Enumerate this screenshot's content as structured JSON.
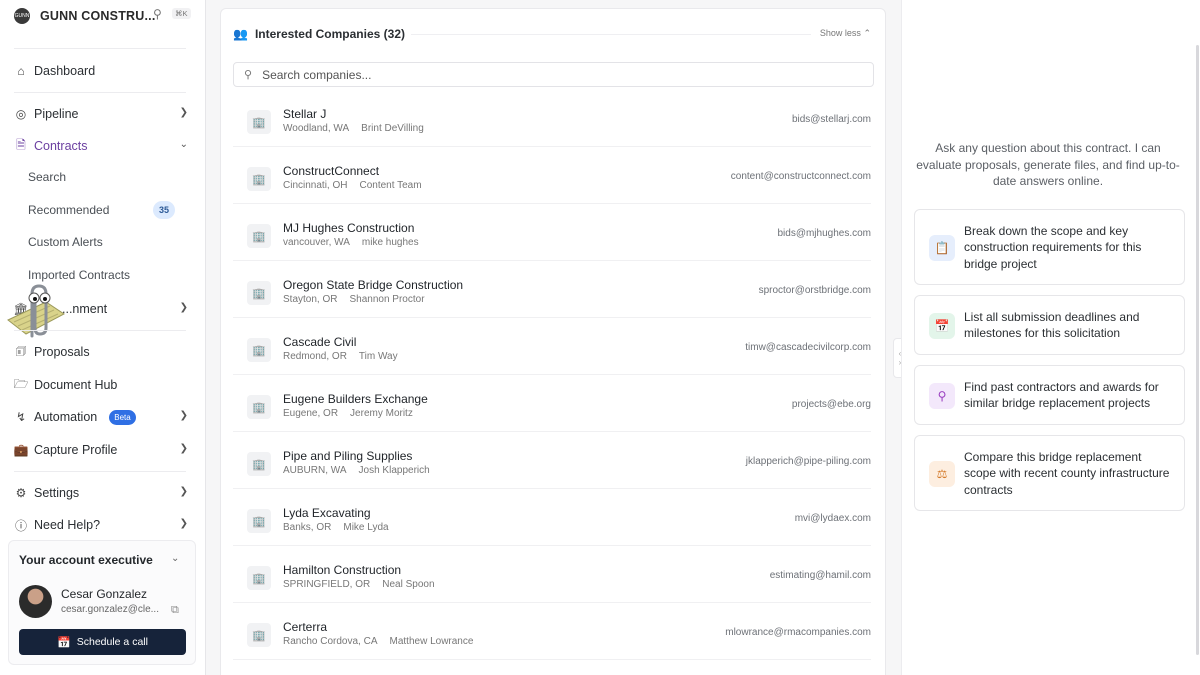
{
  "brand": {
    "name": "GUNN CONSTRU...",
    "logo_text": "GUNN",
    "shortcut": "⌘K"
  },
  "sidebar": {
    "dashboard": "Dashboard",
    "pipeline": "Pipeline",
    "contracts": "Contracts",
    "contracts_sub": {
      "search": "Search",
      "recommended": "Recommended",
      "recommended_count": "35",
      "custom_alerts": "Custom Alerts",
      "imported_contracts": "Imported Contracts",
      "government": "...nment"
    },
    "proposals": "Proposals",
    "document_hub": "Document Hub",
    "automation": "Automation",
    "automation_badge": "Beta",
    "capture_profile": "Capture Profile",
    "settings": "Settings",
    "need_help": "Need Help?"
  },
  "account_exec": {
    "title": "Your account executive",
    "name": "Cesar Gonzalez",
    "email": "cesar.gonzalez@cle...",
    "schedule_label": "Schedule a call"
  },
  "companies_panel": {
    "title": "Interested Companies (32)",
    "toggle": "Show less",
    "search_placeholder": "Search companies...",
    "companies": [
      {
        "name": "Stellar J",
        "location": "Woodland, WA",
        "contact": "Brint DeVilling",
        "email": "bids@stellarj.com"
      },
      {
        "name": "ConstructConnect",
        "location": "Cincinnati, OH",
        "contact": "Content Team",
        "email": "content@constructconnect.com"
      },
      {
        "name": "MJ Hughes Construction",
        "location": "vancouver, WA",
        "contact": "mike hughes",
        "email": "bids@mjhughes.com"
      },
      {
        "name": "Oregon State Bridge Construction",
        "location": "Stayton, OR",
        "contact": "Shannon Proctor",
        "email": "sproctor@orstbridge.com"
      },
      {
        "name": "Cascade Civil",
        "location": "Redmond, OR",
        "contact": "Tim Way",
        "email": "timw@cascadecivilcorp.com"
      },
      {
        "name": "Eugene Builders Exchange",
        "location": "Eugene, OR",
        "contact": "Jeremy Moritz",
        "email": "projects@ebe.org"
      },
      {
        "name": "Pipe and Piling Supplies",
        "location": "AUBURN, WA",
        "contact": "Josh Klapperich",
        "email": "jklapperich@pipe-piling.com"
      },
      {
        "name": "Lyda Excavating",
        "location": "Banks, OR",
        "contact": "Mike Lyda",
        "email": "mvi@lydaex.com"
      },
      {
        "name": "Hamilton Construction",
        "location": "SPRINGFIELD, OR",
        "contact": "Neal Spoon",
        "email": "estimating@hamil.com"
      },
      {
        "name": "Certerra",
        "location": "Rancho Cordova, CA",
        "contact": "Matthew Lowrance",
        "email": "mlowrance@rmacompanies.com"
      }
    ]
  },
  "assistant": {
    "intro": "Ask any question about this contract. I can evaluate proposals, generate files, and find up-to-date answers online.",
    "suggestions": [
      {
        "text": "Break down the scope and key construction requirements for this bridge project",
        "icon": "clipboard-icon",
        "color": "#e6eefc"
      },
      {
        "text": "List all submission deadlines and milestones for this solicitation",
        "icon": "calendar-icon",
        "color": "#e3f5ea"
      },
      {
        "text": "Find past contractors and awards for similar bridge replacement projects",
        "icon": "search-icon",
        "color": "#f3e8fb"
      },
      {
        "text": "Compare this bridge replacement scope with recent county infrastructure contracts",
        "icon": "scale-icon",
        "color": "#fdeee0"
      }
    ]
  }
}
